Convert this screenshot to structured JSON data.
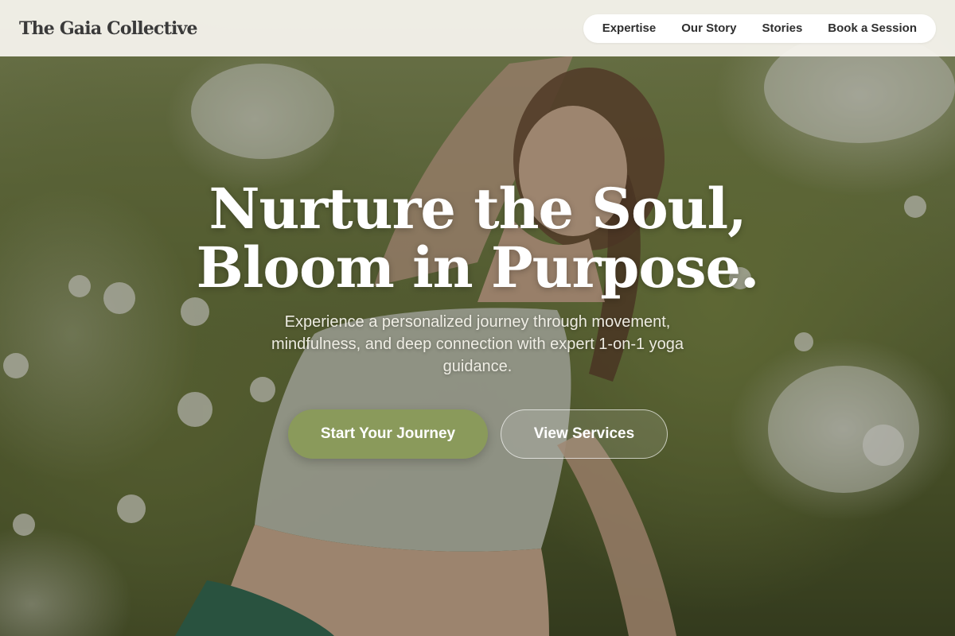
{
  "header": {
    "brand": "The Gaia Collective",
    "nav": [
      {
        "label": "Expertise"
      },
      {
        "label": "Our Story"
      },
      {
        "label": "Stories"
      },
      {
        "label": "Book a Session"
      }
    ]
  },
  "hero": {
    "headline_line1": "Nurture the Soul,",
    "headline_line2": "Bloom in Purpose.",
    "subtitle": "Experience a personalized journey through movement, mindfulness, and deep connection with expert 1-on-1 yoga guidance.",
    "primary_cta": "Start Your Journey",
    "secondary_cta": "View Services",
    "background_image": "woman-stretching-in-meadow-photo"
  },
  "colors": {
    "accent": "#8a9a5b",
    "header_bg": "#f6f4ee",
    "headline": "#ffffff",
    "brand_text": "#3a3a3a"
  }
}
